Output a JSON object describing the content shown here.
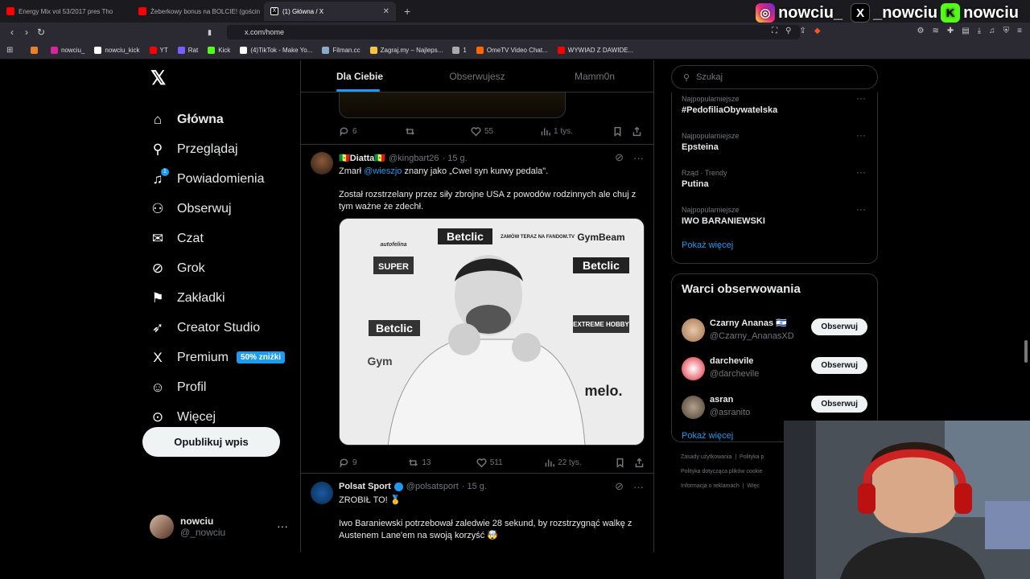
{
  "browser": {
    "tabs": [
      {
        "label": "Energy Mix vol 53/2017 pres Tho",
        "color": "#ff0000"
      },
      {
        "label": "Żeberkowy bonus na BOLCIE! (gościn",
        "color": "#ff0000"
      },
      {
        "label": "(1) Główna / X",
        "color": "#ffffff",
        "active": true
      }
    ],
    "url": "x.com/home",
    "bookmarks": [
      {
        "label": "",
        "color": "#e8822a"
      },
      {
        "label": "nowciu_",
        "color": "#d6249f"
      },
      {
        "label": "nowciu_kick",
        "color": "#ffffff"
      },
      {
        "label": "YT",
        "color": "#ff0000"
      },
      {
        "label": "Rat",
        "color": "#7b5cff"
      },
      {
        "label": "Kick",
        "color": "#53fc18"
      },
      {
        "label": "(4)TikTok - Make Yo...",
        "color": "#ffffff"
      },
      {
        "label": "Filman.cc",
        "color": "#88aacc"
      },
      {
        "label": "Zagraj.my – Najleps...",
        "color": "#f5c542"
      },
      {
        "label": "1",
        "color": "#aaaaaa"
      },
      {
        "label": "OmeTV Video Chat...",
        "color": "#ff6600"
      },
      {
        "label": "WYWIAD Z DAWIDE...",
        "color": "#ff0000"
      }
    ]
  },
  "overlay": {
    "instagram": "nowciu_",
    "x": "_nowciu",
    "kick": "nowciu"
  },
  "nav": {
    "items": [
      {
        "label": "Główna",
        "icon": "home-icon",
        "glyph": "⌂"
      },
      {
        "label": "Przeglądaj",
        "icon": "search-icon",
        "glyph": "⚲"
      },
      {
        "label": "Powiadomienia",
        "icon": "bell-icon",
        "glyph": "🔔"
      },
      {
        "label": "Obserwuj",
        "icon": "follow-icon",
        "glyph": "⚇"
      },
      {
        "label": "Czat",
        "icon": "mail-icon",
        "glyph": "✉"
      },
      {
        "label": "Grok",
        "icon": "grok-icon",
        "glyph": "⊘"
      },
      {
        "label": "Zakładki",
        "icon": "bookmark-icon",
        "glyph": "⚑"
      },
      {
        "label": "Creator Studio",
        "icon": "rocket-icon",
        "glyph": "➶"
      },
      {
        "label": "Premium",
        "icon": "x-icon",
        "glyph": "𝕏"
      },
      {
        "label": "Profil",
        "icon": "profile-icon",
        "glyph": "⚲"
      },
      {
        "label": "Więcej",
        "icon": "more-icon",
        "glyph": "⋯"
      }
    ],
    "notif_count": "1",
    "premium_badge": "50% zniżki",
    "post_button": "Opublikuj wpis",
    "profile_name": "nowciu",
    "profile_handle": "@_nowciu"
  },
  "feed": {
    "tabs": [
      "Dla Ciebie",
      "Obserwujesz",
      "Mamm0n"
    ],
    "prev_stats": {
      "replies": "6",
      "reposts": "",
      "likes": "55",
      "views": "1 tys."
    },
    "tweet1": {
      "name": "🇸🇳Diatta🇸🇳",
      "handle": "@kingbart26",
      "time": "· 15 g.",
      "line1_pre": "Zmarł",
      "mention": "@wieszjo",
      "line1_post": "znany jako „Cwel syn kurwy pedala\".",
      "line2": "Został rozstrzelany przez siły zbrojne USA z powodów rodzinnych ale chuj z tym ważne że zdechł.",
      "stats": {
        "replies": "9",
        "reposts": "13",
        "likes": "511",
        "views": "22 tys."
      },
      "sponsors": [
        "Betclic",
        "GymBeam",
        "SUPER",
        "Betclic",
        "EXTREME HOBBY",
        "Betclic",
        "melo.",
        "Gym",
        "autofelina",
        "ZAMÓW TERAZ NA FANDOM.TV"
      ]
    },
    "tweet2": {
      "name": "Polsat Sport",
      "handle": "@polsatsport",
      "time": "· 15 g.",
      "line1": "ZROBIŁ TO! 🥇",
      "line2": "Iwo Baraniewski potrzebował zaledwie 28 sekund, by rozstrzygnąć walkę z Austenem Lane'em na swoją korzyść 🤯"
    }
  },
  "sidebar": {
    "search_placeholder": "Szukaj",
    "trends": [
      {
        "category": "Najpopularniejsze",
        "name": "#PedofiliaObywatelska"
      },
      {
        "category": "Najpopularniejsze",
        "name": "Epsteina"
      },
      {
        "category": "Rząd · Trendy",
        "name": "Putina"
      },
      {
        "category": "Najpopularniejsze",
        "name": "IWO BARANIEWSKI"
      }
    ],
    "show_more": "Pokaż więcej",
    "follow_title": "Warci obserwowania",
    "suggestions": [
      {
        "name": "Czarny Ananas 🇮🇱",
        "handle": "@Czarny_AnanasXD"
      },
      {
        "name": "darchevile",
        "handle": "@darchevile"
      },
      {
        "name": "asran",
        "handle": "@asranito"
      }
    ],
    "follow_label": "Obserwuj",
    "footer": [
      "Zasady użytkowania",
      "|",
      "Polityka p",
      "Polityka dotycząca plików cookie",
      "Informacja o reklamach",
      "|",
      "Więc"
    ]
  }
}
